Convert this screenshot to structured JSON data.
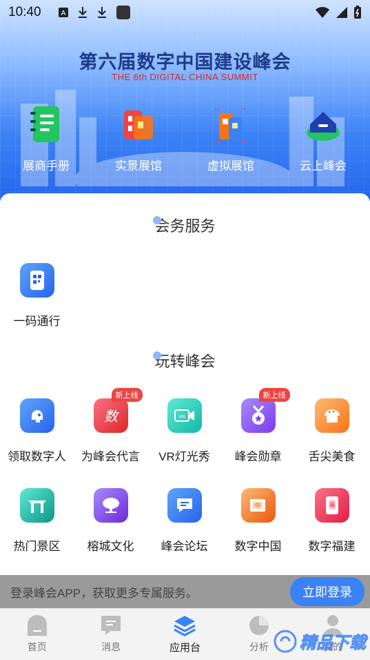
{
  "status_bar": {
    "time": "10:40"
  },
  "hero": {
    "title": "第六届数字中国建设峰会",
    "subtitle": "THE 6th DIGITAL CHINA SUMMIT",
    "quick": [
      {
        "label": "展商手册",
        "icon": "notebook-icon"
      },
      {
        "label": "实景展馆",
        "icon": "building-icon"
      },
      {
        "label": "虚拟展馆",
        "icon": "virtual-building-icon"
      },
      {
        "label": "云上峰会",
        "icon": "cloud-icon"
      }
    ]
  },
  "sections": {
    "meeting": {
      "title_a": "会务服",
      "title_b": "务"
    },
    "fun": {
      "title_a": "玩转峰",
      "title_b": "会"
    }
  },
  "meeting_items": [
    {
      "label": "一码通行",
      "icon": "qr-pass-icon"
    }
  ],
  "fun_items": [
    {
      "label": "领取数字人",
      "icon": "digital-human-icon",
      "badge": ""
    },
    {
      "label": "为峰会代言",
      "icon": "endorse-icon",
      "badge": "新上线"
    },
    {
      "label": "VR灯光秀",
      "icon": "vr-icon",
      "badge": ""
    },
    {
      "label": "峰会勋章",
      "icon": "medal-icon",
      "badge": "新上线"
    },
    {
      "label": "舌尖美食",
      "icon": "food-icon",
      "badge": ""
    },
    {
      "label": "热门景区",
      "icon": "scenic-icon",
      "badge": ""
    },
    {
      "label": "榕城文化",
      "icon": "banyan-icon",
      "badge": ""
    },
    {
      "label": "峰会论坛",
      "icon": "forum-icon",
      "badge": ""
    },
    {
      "label": "数字中国",
      "icon": "digital-china-icon",
      "badge": ""
    },
    {
      "label": "数字福建",
      "icon": "digital-fujian-icon",
      "badge": ""
    }
  ],
  "login": {
    "text": "登录峰会APP，获取更多专属服务。",
    "button": "立即登录"
  },
  "tabs": [
    {
      "label": "首页",
      "icon": "home-icon"
    },
    {
      "label": "消息",
      "icon": "message-icon"
    },
    {
      "label": "应用台",
      "icon": "layers-icon"
    },
    {
      "label": "分析",
      "icon": "pie-chart-icon"
    },
    {
      "label": "我的",
      "icon": "user-icon"
    }
  ],
  "watermark": {
    "text": "精品下载"
  },
  "colors": {
    "brand": "#3b82f6",
    "badge": "#ef4444"
  }
}
